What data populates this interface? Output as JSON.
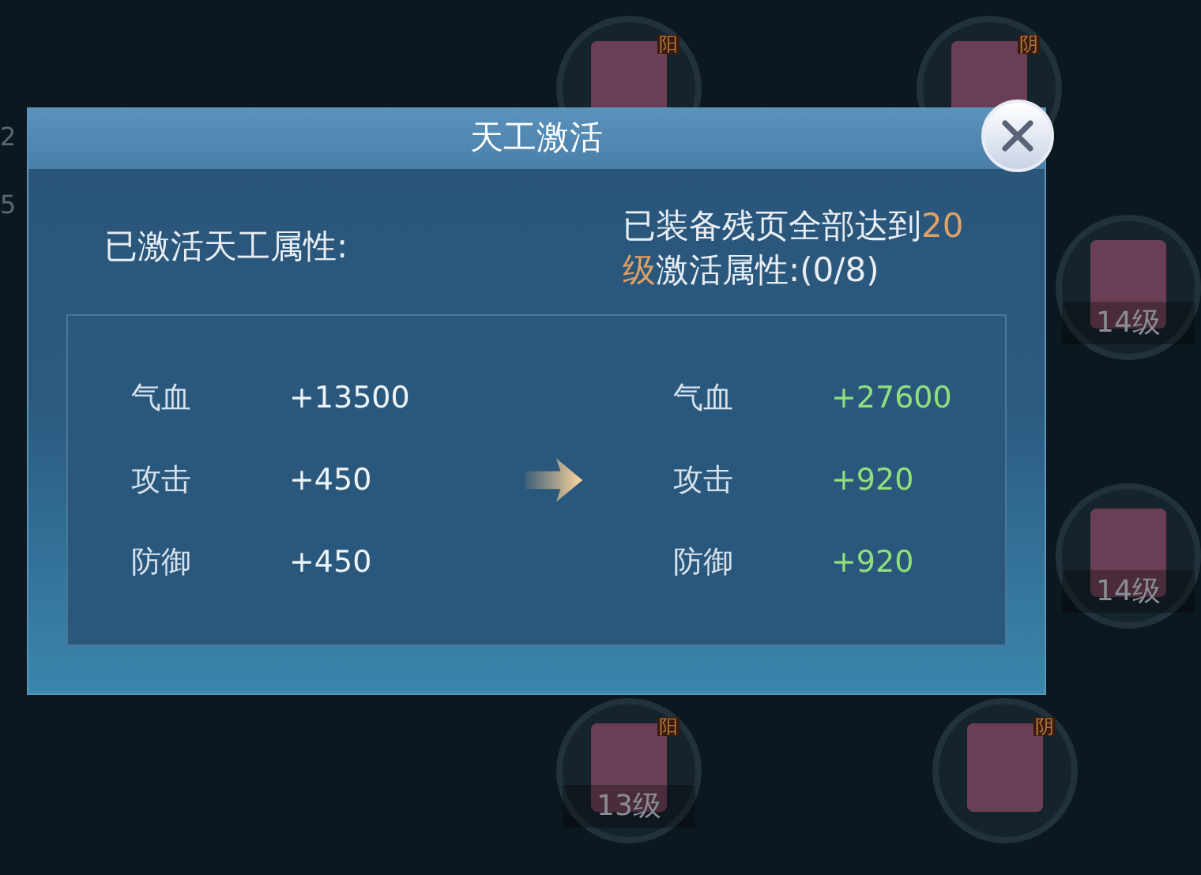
{
  "background_slots": [
    {
      "badge": "阳"
    },
    {
      "badge": "阴"
    },
    {
      "level": "14级"
    },
    {
      "level": "14级"
    },
    {
      "badge": "阳",
      "level": "13级"
    },
    {
      "badge": "阴"
    }
  ],
  "background_numbers": [
    "2",
    "5"
  ],
  "dialog": {
    "title": "天工激活",
    "current_heading": "已激活天工属性:",
    "requirement": {
      "before": "已装备残页全部达到",
      "level": "20级",
      "after": "激活属性:(0/8)"
    },
    "current_stats": [
      {
        "label": "气血",
        "value": "+13500"
      },
      {
        "label": "攻击",
        "value": "+450"
      },
      {
        "label": "防御",
        "value": "+450"
      }
    ],
    "next_stats": [
      {
        "label": "气血",
        "value": "+27600"
      },
      {
        "label": "攻击",
        "value": "+920"
      },
      {
        "label": "防御",
        "value": "+920"
      }
    ]
  }
}
